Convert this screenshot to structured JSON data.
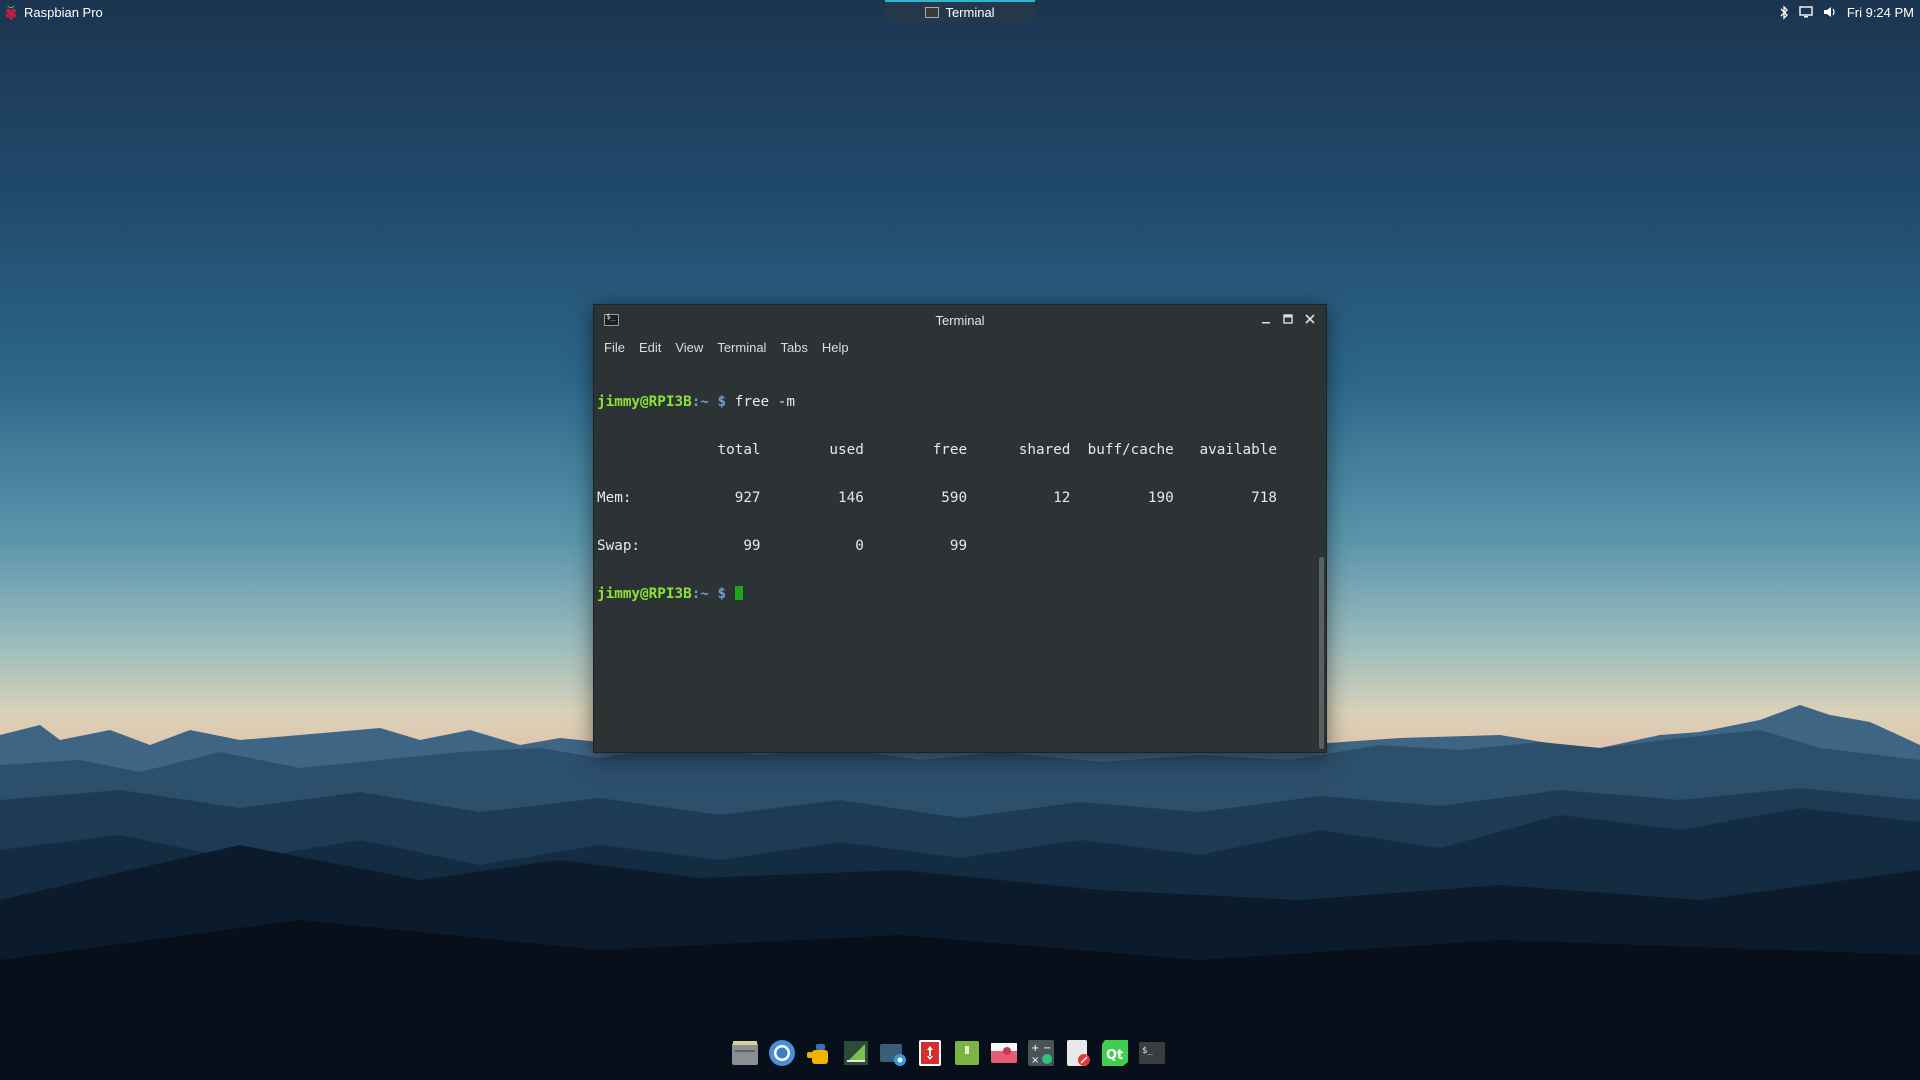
{
  "top_panel": {
    "menu_label": "Raspbian Pro",
    "task_label": "Terminal",
    "clock": "Fri  9:24 PM",
    "tray_icons": [
      "bluetooth-icon",
      "display-icon",
      "volume-icon"
    ]
  },
  "terminal": {
    "title": "Terminal",
    "menu": [
      "File",
      "Edit",
      "View",
      "Terminal",
      "Tabs",
      "Help"
    ],
    "prompt_user": "jimmy@RPI3B",
    "prompt_path": ":~",
    "prompt_symbol": "$",
    "command": "free -m",
    "header": "              total        used        free      shared  buff/cache   available",
    "rows": [
      "Mem:            927         146         590          12         190         718",
      "Swap:            99           0          99"
    ]
  },
  "dock": {
    "items": [
      "file-manager-icon",
      "chromium-icon",
      "python-idle-icon",
      "geany-icon",
      "screenshot-icon",
      "sd-card-copier-icon",
      "archive-icon",
      "image-viewer-icon",
      "calculator-icon",
      "text-editor-icon",
      "qt-creator-icon",
      "terminal-icon"
    ]
  },
  "colors": {
    "panel_accent": "#29b6d6",
    "prompt_user": "#8ae234",
    "prompt_symbol": "#729fcf",
    "cursor": "#1ea51e",
    "terminal_bg": "#2d3335"
  }
}
